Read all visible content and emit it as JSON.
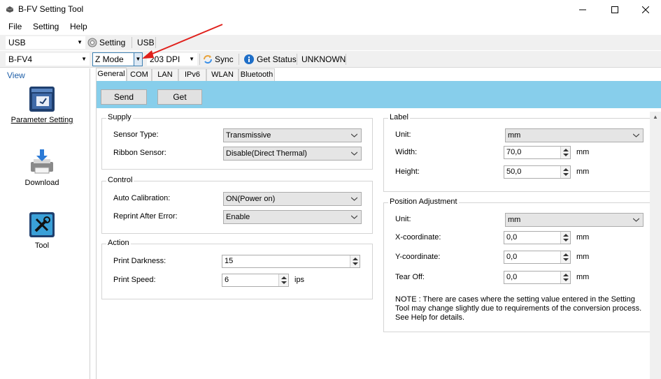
{
  "window": {
    "title": "B-FV Setting Tool"
  },
  "menu": {
    "file": "File",
    "setting": "Setting",
    "help": "Help"
  },
  "toolbar1": {
    "port_select": "USB",
    "setting_label": "Setting",
    "port_text": "USB"
  },
  "toolbar2": {
    "model_select": "B-FV4",
    "mode_select": "Z Mode",
    "dpi_select": "203 DPI",
    "sync_label": "Sync",
    "get_status_label": "Get Status",
    "status_value": "UNKNOWN"
  },
  "sidebar": {
    "view_label": "View",
    "items": [
      {
        "label": "Parameter Setting",
        "icon": "parameter-setting-icon"
      },
      {
        "label": "Download",
        "icon": "download-printer-icon"
      },
      {
        "label": "Tool",
        "icon": "tool-icon"
      }
    ]
  },
  "tabs": [
    "General",
    "COM",
    "LAN",
    "IPv6",
    "WLAN",
    "Bluetooth"
  ],
  "buttons": {
    "send": "Send",
    "get": "Get"
  },
  "supply": {
    "legend": "Supply",
    "sensor_type_label": "Sensor Type:",
    "sensor_type_value": "Transmissive",
    "ribbon_sensor_label": "Ribbon Sensor:",
    "ribbon_sensor_value": "Disable(Direct Thermal)"
  },
  "control": {
    "legend": "Control",
    "auto_calibration_label": "Auto Calibration:",
    "auto_calibration_value": "ON(Power on)",
    "reprint_label": "Reprint After Error:",
    "reprint_value": "Enable"
  },
  "action": {
    "legend": "Action",
    "darkness_label": "Print Darkness:",
    "darkness_value": "15",
    "speed_label": "Print Speed:",
    "speed_value": "6",
    "speed_unit": "ips"
  },
  "label": {
    "legend": "Label",
    "unit_label": "Unit:",
    "unit_value": "mm",
    "width_label": "Width:",
    "width_value": "70,0",
    "width_unit": "mm",
    "height_label": "Height:",
    "height_value": "50,0",
    "height_unit": "mm"
  },
  "position": {
    "legend": "Position Adjustment",
    "unit_label": "Unit:",
    "unit_value": "mm",
    "x_label": "X-coordinate:",
    "x_value": "0,0",
    "x_unit": "mm",
    "y_label": "Y-coordinate:",
    "y_value": "0,0",
    "y_unit": "mm",
    "tear_label": "Tear Off:",
    "tear_value": "0,0",
    "tear_unit": "mm",
    "note": "NOTE : There are cases where the setting value entered in the Setting Tool may change slightly due to requirements of the conversion process. See Help for details."
  },
  "colors": {
    "accent_bar": "#87ceeb",
    "annotation_arrow": "#e0201b",
    "link_blue": "#1f5fa8"
  }
}
